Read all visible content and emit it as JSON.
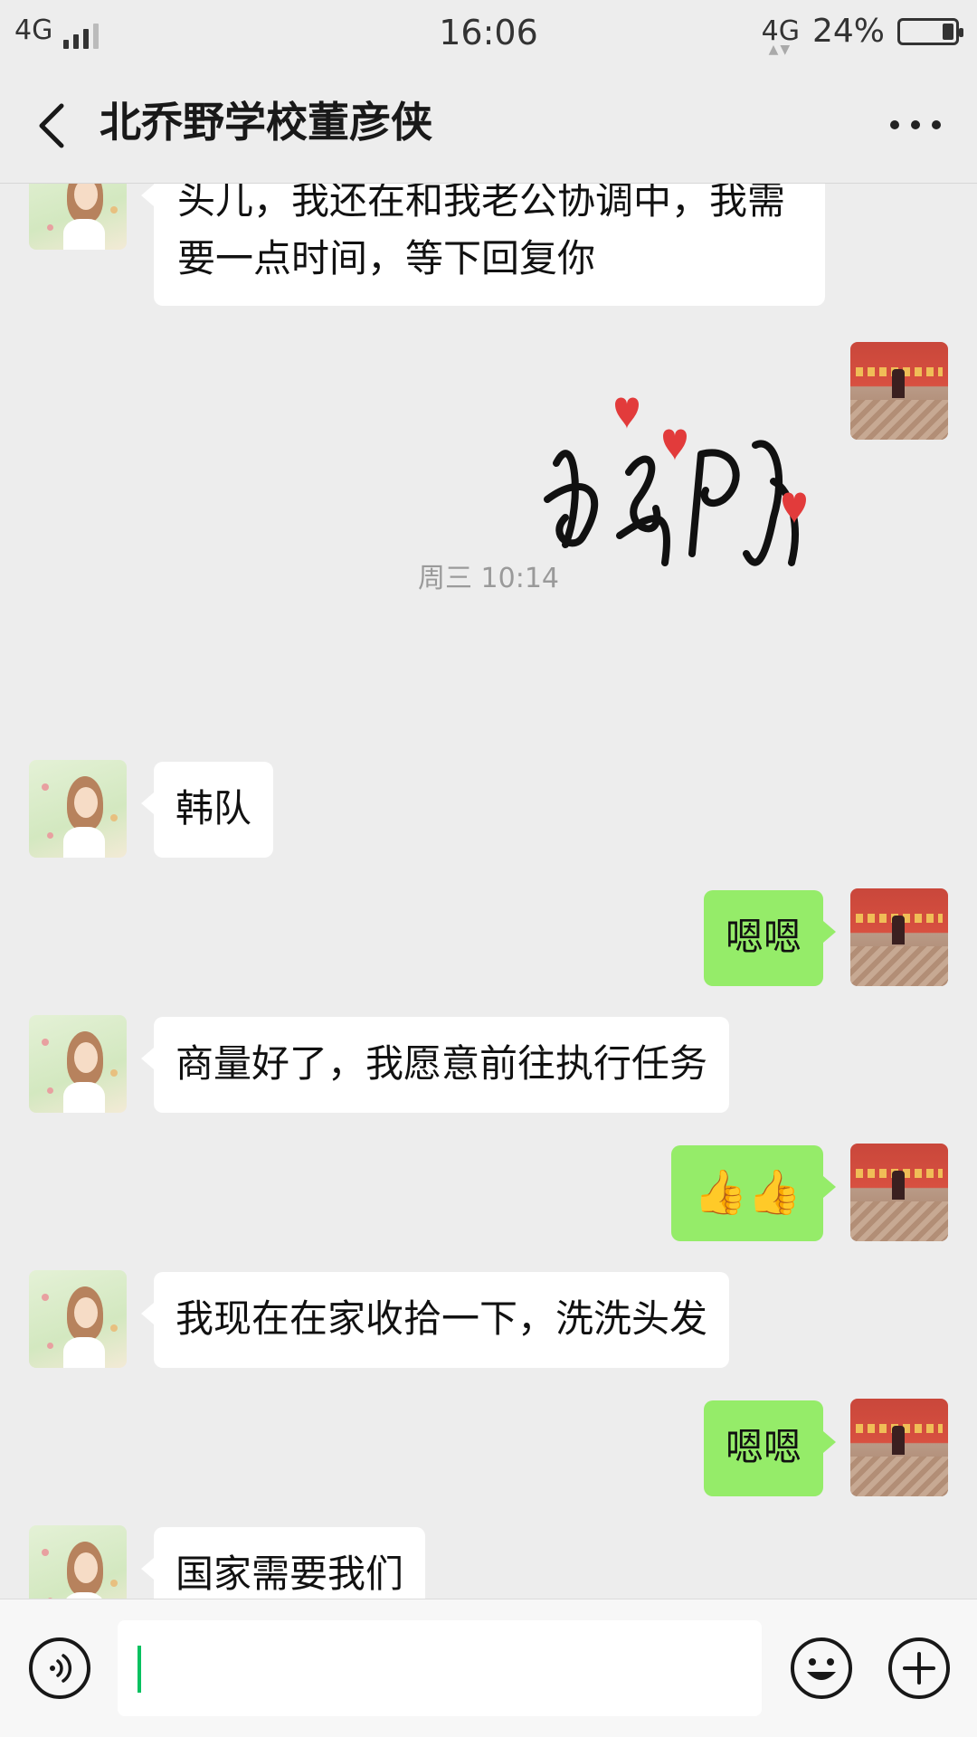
{
  "status_bar": {
    "network_left": "4G",
    "time": "16:06",
    "network_right": "4G",
    "battery": "24%"
  },
  "nav": {
    "title": "北乔野学校董彦侠"
  },
  "messages": {
    "m1": "头儿，我还在和我老公协调中，我需要一点时间，等下回复你",
    "time_divider": "周三 10:14",
    "m2": "韩队",
    "m3": "嗯嗯",
    "m4": "商量好了，我愿意前往执行任务",
    "m5": "👍👍",
    "m6": "我现在在家收拾一下，洗洗头发",
    "m7": "嗯嗯",
    "m8": "国家需要我们"
  },
  "sticker": {
    "text": "好的"
  },
  "colors": {
    "background": "#ededed",
    "bubble_self": "#95ec69",
    "bubble_other": "#ffffff",
    "caret": "#07c160"
  }
}
